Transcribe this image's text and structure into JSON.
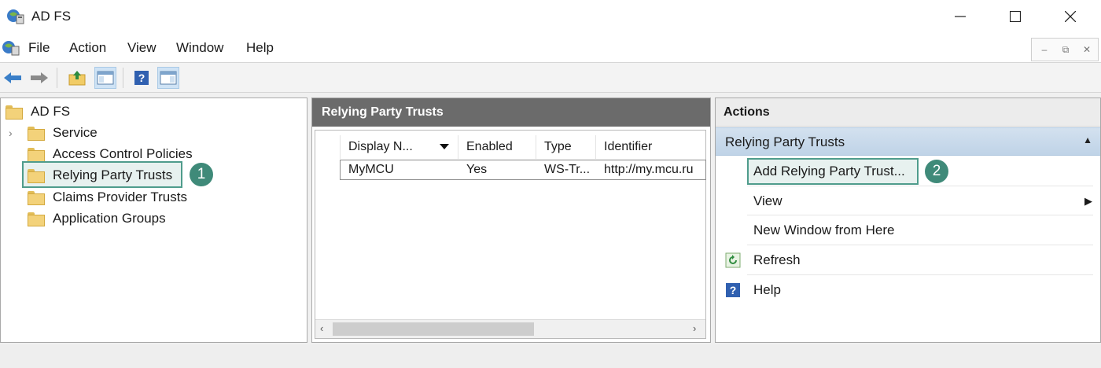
{
  "window": {
    "title": "AD FS"
  },
  "menu": [
    "File",
    "Action",
    "View",
    "Window",
    "Help"
  ],
  "tree": {
    "root": "AD FS",
    "items": [
      "Service",
      "Access Control Policies",
      "Relying Party Trusts",
      "Claims Provider Trusts",
      "Application Groups"
    ],
    "selected": "Relying Party Trusts"
  },
  "middle": {
    "header": "Relying Party Trusts",
    "columns": [
      "Display N...",
      "Enabled",
      "Type",
      "Identifier"
    ],
    "rows": [
      {
        "display_name": "MyMCU",
        "enabled": "Yes",
        "type": "WS-Tr...",
        "identifier": "http://my.mcu.ru"
      }
    ]
  },
  "actions": {
    "header": "Actions",
    "section": "Relying Party Trusts",
    "items": [
      "Add Relying Party Trust...",
      "View",
      "New Window from Here",
      "Refresh",
      "Help"
    ]
  },
  "callouts": [
    "1",
    "2"
  ],
  "colors": {
    "highlight": "#4f9c8c",
    "badge": "#3f8a79",
    "section_bg": "#c8d9eb",
    "panel_header": "#6b6b6b"
  }
}
